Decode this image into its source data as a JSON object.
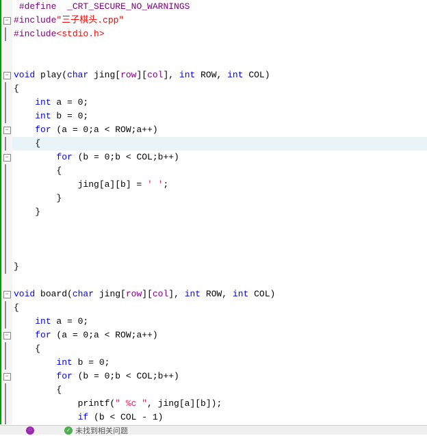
{
  "lines": [
    {
      "fold": null,
      "segs": [
        {
          "t": " ",
          "c": ""
        },
        {
          "t": "#define",
          "c": "macro"
        },
        {
          "t": "  ",
          "c": ""
        },
        {
          "t": "_CRT_SECURE_NO_WARNINGS",
          "c": "kw-purple"
        }
      ]
    },
    {
      "fold": "minus",
      "segs": [
        {
          "t": "#include",
          "c": "macro"
        },
        {
          "t": "\"三子棋头.cpp\"",
          "c": "str-red"
        }
      ]
    },
    {
      "fold": "vline",
      "segs": [
        {
          "t": "#include",
          "c": "macro"
        },
        {
          "t": "<stdio.h>",
          "c": "str-red"
        }
      ]
    },
    {
      "fold": null,
      "segs": []
    },
    {
      "fold": null,
      "segs": []
    },
    {
      "fold": "minus",
      "segs": [
        {
          "t": "void",
          "c": "kw-blue"
        },
        {
          "t": " play(",
          "c": ""
        },
        {
          "t": "char",
          "c": "kw-blue"
        },
        {
          "t": " jing[",
          "c": ""
        },
        {
          "t": "row",
          "c": "kw-purple"
        },
        {
          "t": "][",
          "c": ""
        },
        {
          "t": "col",
          "c": "kw-purple"
        },
        {
          "t": "], ",
          "c": ""
        },
        {
          "t": "int",
          "c": "kw-blue"
        },
        {
          "t": " ROW, ",
          "c": ""
        },
        {
          "t": "int",
          "c": "kw-blue"
        },
        {
          "t": " COL)",
          "c": ""
        }
      ]
    },
    {
      "fold": "vline",
      "segs": [
        {
          "t": "{",
          "c": ""
        }
      ]
    },
    {
      "fold": "vline",
      "segs": [
        {
          "t": "    ",
          "c": ""
        },
        {
          "t": "int",
          "c": "kw-blue"
        },
        {
          "t": " a = 0;",
          "c": ""
        }
      ]
    },
    {
      "fold": "vline",
      "segs": [
        {
          "t": "    ",
          "c": ""
        },
        {
          "t": "int",
          "c": "kw-blue"
        },
        {
          "t": " b = 0;",
          "c": ""
        }
      ]
    },
    {
      "fold": "minus",
      "segs": [
        {
          "t": "    ",
          "c": ""
        },
        {
          "t": "for",
          "c": "kw-blue"
        },
        {
          "t": " (a = 0;a < ROW;a++)",
          "c": ""
        }
      ]
    },
    {
      "fold": "vline",
      "hl": true,
      "segs": [
        {
          "t": "    {",
          "c": ""
        }
      ]
    },
    {
      "fold": "minus",
      "segs": [
        {
          "t": "        ",
          "c": ""
        },
        {
          "t": "for",
          "c": "kw-blue"
        },
        {
          "t": " (b = 0;b < COL;b++)",
          "c": ""
        }
      ]
    },
    {
      "fold": "vline",
      "segs": [
        {
          "t": "        {",
          "c": ""
        }
      ]
    },
    {
      "fold": "vline",
      "segs": [
        {
          "t": "            jing[a][b] = ",
          "c": ""
        },
        {
          "t": "' '",
          "c": "str-pink"
        },
        {
          "t": ";",
          "c": ""
        }
      ]
    },
    {
      "fold": "vline",
      "segs": [
        {
          "t": "        }",
          "c": ""
        }
      ]
    },
    {
      "fold": "vline",
      "segs": [
        {
          "t": "    }",
          "c": ""
        }
      ]
    },
    {
      "fold": "vline",
      "segs": []
    },
    {
      "fold": "vline",
      "segs": []
    },
    {
      "fold": "vline",
      "segs": []
    },
    {
      "fold": "vline",
      "segs": [
        {
          "t": "}",
          "c": ""
        }
      ]
    },
    {
      "fold": null,
      "segs": []
    },
    {
      "fold": "minus",
      "segs": [
        {
          "t": "void",
          "c": "kw-blue"
        },
        {
          "t": " board(",
          "c": ""
        },
        {
          "t": "char",
          "c": "kw-blue"
        },
        {
          "t": " jing[",
          "c": ""
        },
        {
          "t": "row",
          "c": "kw-purple"
        },
        {
          "t": "][",
          "c": ""
        },
        {
          "t": "col",
          "c": "kw-purple"
        },
        {
          "t": "], ",
          "c": ""
        },
        {
          "t": "int",
          "c": "kw-blue"
        },
        {
          "t": " ROW, ",
          "c": ""
        },
        {
          "t": "int",
          "c": "kw-blue"
        },
        {
          "t": " COL)",
          "c": ""
        }
      ]
    },
    {
      "fold": "vline",
      "segs": [
        {
          "t": "{",
          "c": ""
        }
      ]
    },
    {
      "fold": "vline",
      "segs": [
        {
          "t": "    ",
          "c": ""
        },
        {
          "t": "int",
          "c": "kw-blue"
        },
        {
          "t": " a = 0;",
          "c": ""
        }
      ]
    },
    {
      "fold": "minus",
      "segs": [
        {
          "t": "    ",
          "c": ""
        },
        {
          "t": "for",
          "c": "kw-blue"
        },
        {
          "t": " (a = 0;a < ROW;a++)",
          "c": ""
        }
      ]
    },
    {
      "fold": "vline",
      "segs": [
        {
          "t": "    {",
          "c": ""
        }
      ]
    },
    {
      "fold": "vline",
      "segs": [
        {
          "t": "        ",
          "c": ""
        },
        {
          "t": "int",
          "c": "kw-blue"
        },
        {
          "t": " b = 0;",
          "c": ""
        }
      ]
    },
    {
      "fold": "minus",
      "segs": [
        {
          "t": "        ",
          "c": ""
        },
        {
          "t": "for",
          "c": "kw-blue"
        },
        {
          "t": " (b = 0;b < COL;b++)",
          "c": ""
        }
      ]
    },
    {
      "fold": "vline",
      "segs": [
        {
          "t": "        {",
          "c": ""
        }
      ]
    },
    {
      "fold": "vline",
      "segs": [
        {
          "t": "            printf(",
          "c": ""
        },
        {
          "t": "\" %c \"",
          "c": "str-pink"
        },
        {
          "t": ", jing[a][b]);",
          "c": ""
        }
      ]
    },
    {
      "fold": "vline",
      "segs": [
        {
          "t": "            ",
          "c": ""
        },
        {
          "t": "if",
          "c": "kw-blue"
        },
        {
          "t": " (b < COL - 1)",
          "c": ""
        }
      ]
    }
  ],
  "status": {
    "text": "未找到相关问题"
  }
}
